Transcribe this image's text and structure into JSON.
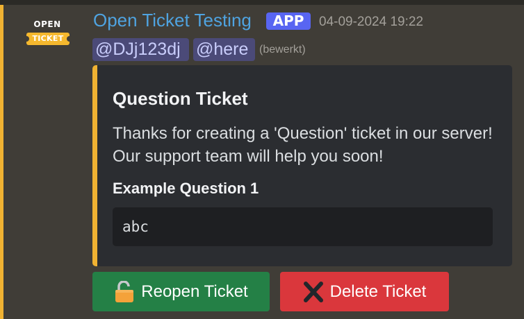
{
  "message": {
    "avatar": {
      "icon": "open-ticket-logo-icon",
      "line1": "OPEN",
      "line2": "TICKET"
    },
    "author": "Open Ticket Testing",
    "badge": "APP",
    "timestamp": "04-09-2024 19:22",
    "mentions": [
      "@DJj123dj",
      "@here"
    ],
    "edited": "(bewerkt)",
    "accent_color": "#f0b232"
  },
  "embed": {
    "title": "Question Ticket",
    "description_line1": "Thanks for creating a 'Question' ticket in our server!",
    "description_line2": "Our support team will help you soon!",
    "field_name": "Example Question 1",
    "field_value": "abc"
  },
  "buttons": [
    {
      "label": "Reopen Ticket",
      "icon": "unlocked-padlock-icon",
      "color": "#248046"
    },
    {
      "label": "Delete Ticket",
      "icon": "cross-mark-icon",
      "color": "#da373c"
    }
  ]
}
